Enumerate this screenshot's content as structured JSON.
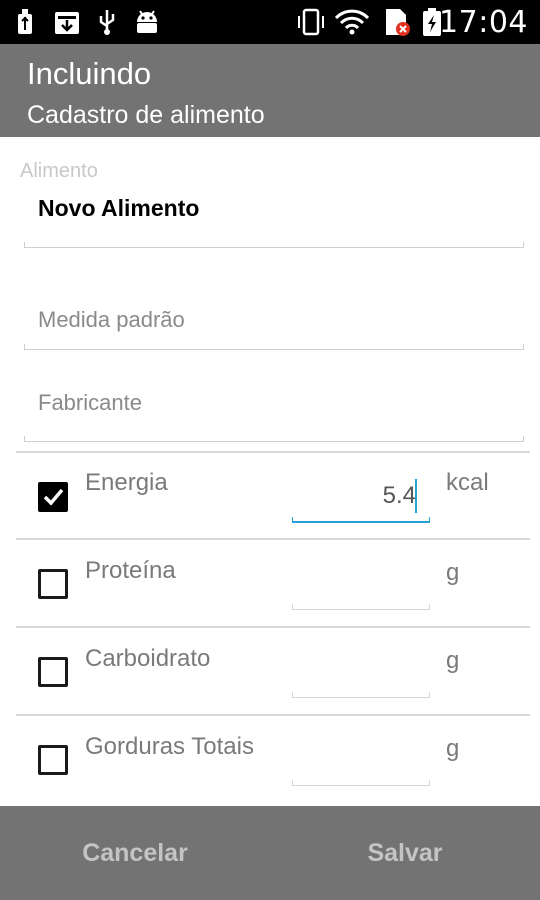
{
  "status_bar": {
    "time": "17:04",
    "icons": [
      "usb-debug-icon",
      "download-icon",
      "usb-icon",
      "android-icon",
      "vibrate-icon",
      "wifi-icon",
      "no-sim-icon",
      "battery-charging-icon"
    ]
  },
  "action_bar": {
    "title": "Incluindo",
    "subtitle": "Cadastro de alimento"
  },
  "form": {
    "alimento_label": "Alimento",
    "alimento_value": "Novo Alimento",
    "medida_placeholder": "Medida padrão",
    "fabricante_placeholder": "Fabricante"
  },
  "nutrients": [
    {
      "label": "Energia",
      "value": "5.4",
      "unit": "kcal",
      "checked": true
    },
    {
      "label": "Proteína",
      "value": "",
      "unit": "g",
      "checked": false
    },
    {
      "label": "Carboidrato",
      "value": "",
      "unit": "g",
      "checked": false
    },
    {
      "label": "Gorduras Totais",
      "value": "",
      "unit": "g",
      "checked": false
    }
  ],
  "buttons": {
    "cancel": "Cancelar",
    "save": "Salvar"
  },
  "colors": {
    "action_bar": "#737373",
    "accent": "#2a9fd6",
    "status_bar": "#000000"
  }
}
